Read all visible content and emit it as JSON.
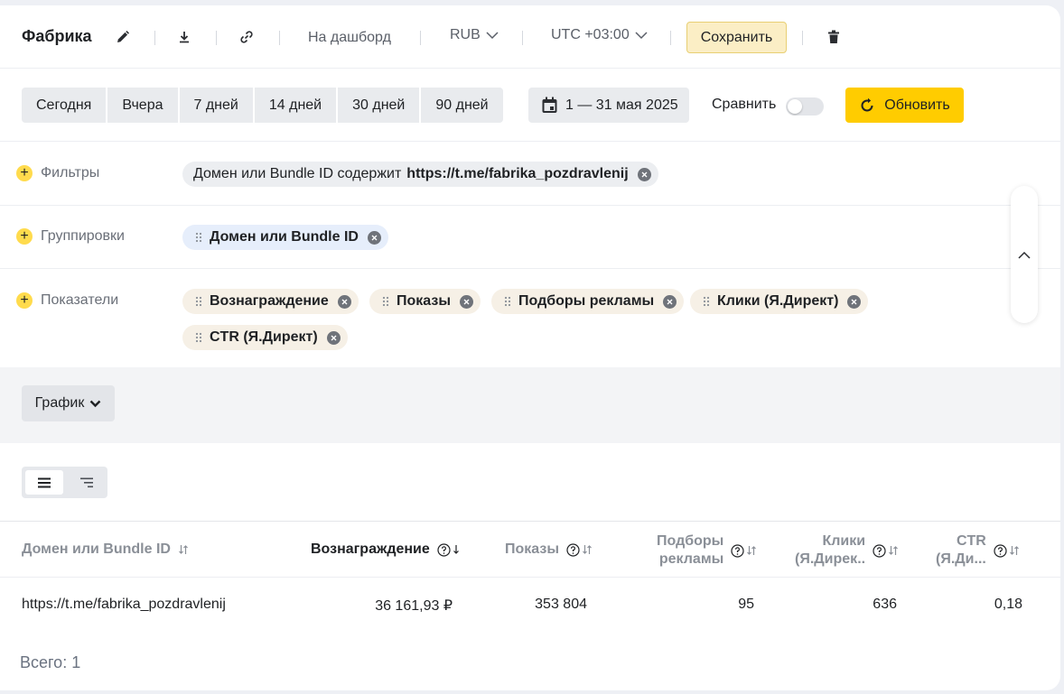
{
  "header": {
    "title": "Фабрика",
    "to_dashboard": "На дашборд",
    "currency": "RUB",
    "timezone": "UTC +03:00",
    "save": "Сохранить"
  },
  "period": {
    "buttons": [
      "Сегодня",
      "Вчера",
      "7 дней",
      "14 дней",
      "30 дней",
      "90 дней"
    ],
    "date_range": "1 — 31 мая 2025",
    "compare": "Сравнить",
    "compare_on": false,
    "refresh": "Обновить"
  },
  "filters": {
    "label": "Фильтры",
    "chip_prefix": "Домен или Bundle ID содержит",
    "chip_value": "https://t.me/fabrika_pozdravlenij"
  },
  "groupings": {
    "label": "Группировки",
    "items": [
      "Домен или Bundle ID"
    ]
  },
  "metrics": {
    "label": "Показатели",
    "items": [
      "Вознаграждение",
      "Показы",
      "Подборы рекламы",
      "Клики (Я.Директ)",
      "CTR (Я.Директ)"
    ]
  },
  "chart_toggle": "График",
  "table": {
    "columns": {
      "domain": "Домен или Bundle ID",
      "reward": "Вознаграждение",
      "shows": "Показы",
      "selections_1": "Подборы",
      "selections_2": "рекламы",
      "clicks_1": "Клики",
      "clicks_2": "(Я.Дирек..",
      "ctr_1": "CTR",
      "ctr_2": "(Я.Ди..."
    },
    "rows": [
      {
        "domain": "https://t.me/fabrika_pozdravlenij",
        "reward": "36 161,93 ₽",
        "shows": "353 804",
        "selections": "95",
        "clicks": "636",
        "ctr": "0,18"
      }
    ],
    "total": "Всего: 1"
  },
  "colors": {
    "accent": "#ffcc00",
    "save_bg": "#fbeec5",
    "plus": "#ffdb4d"
  }
}
